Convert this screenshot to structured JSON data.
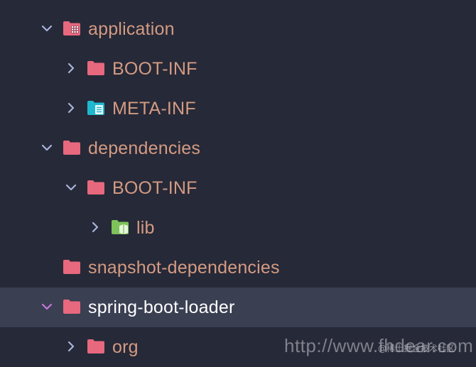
{
  "colors": {
    "background": "#262938",
    "selected_row": "#3a3f52",
    "label": "#d49b82",
    "label_selected": "#ffffff",
    "folder": "#e8687e",
    "folder_teal": "#1fb8cf",
    "folder_green": "#7ec35a",
    "chevron": "#a8b4d8",
    "chevron_selected": "#c678dd"
  },
  "tree": {
    "items": [
      {
        "label": "application",
        "expanded": true,
        "icon": "module-folder-icon"
      },
      {
        "label": "BOOT-INF",
        "expanded": false,
        "icon": "folder-icon"
      },
      {
        "label": "META-INF",
        "expanded": false,
        "icon": "meta-folder-icon"
      },
      {
        "label": "dependencies",
        "expanded": true,
        "icon": "folder-icon"
      },
      {
        "label": "BOOT-INF",
        "expanded": true,
        "icon": "folder-icon"
      },
      {
        "label": "lib",
        "expanded": false,
        "icon": "library-folder-icon"
      },
      {
        "label": "snapshot-dependencies",
        "expanded": false,
        "icon": "folder-icon"
      },
      {
        "label": "spring-boot-loader",
        "expanded": true,
        "selected": true,
        "icon": "folder-icon"
      },
      {
        "label": "org",
        "expanded": false,
        "icon": "folder-icon"
      }
    ]
  },
  "watermark": {
    "url_text": "http://www.fhdear.com",
    "overlay_text": "@稀土掘金技术社区"
  }
}
